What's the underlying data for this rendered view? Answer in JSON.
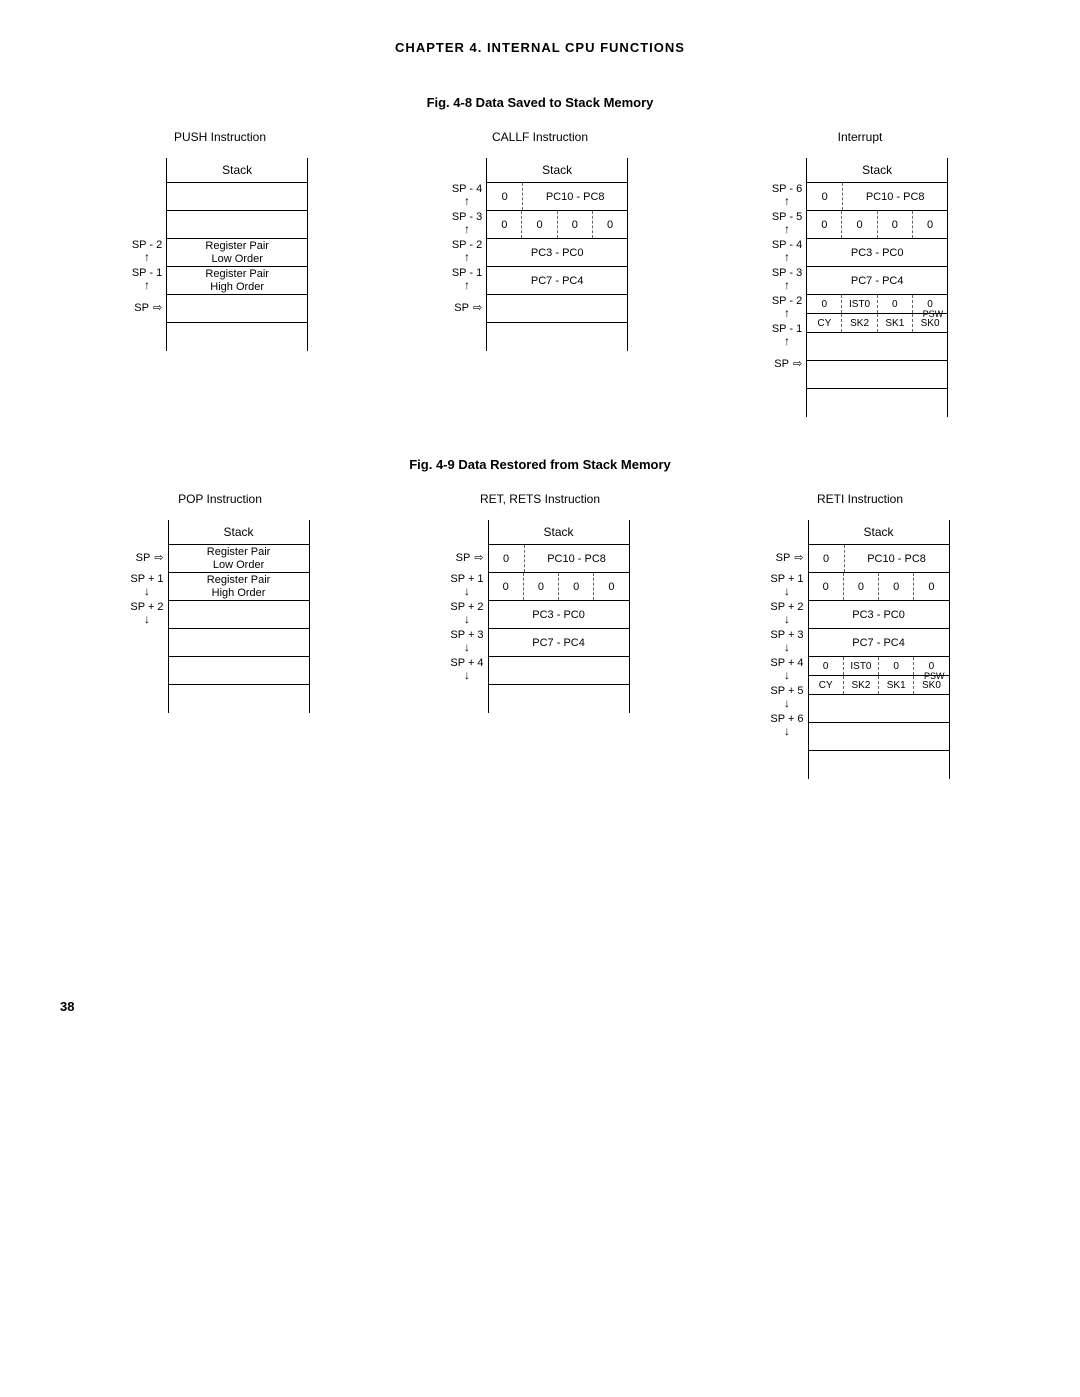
{
  "page_header": "CHAPTER  4.  INTERNAL  CPU  FUNCTIONS",
  "fig48_title": "Fig. 4-8 Data Saved to Stack Memory",
  "fig49_title": "Fig. 4-9 Data Restored from Stack Memory",
  "page_number": "38",
  "stack_label": "Stack",
  "push": {
    "title": "PUSH Instruction",
    "sp": [
      "",
      "",
      "SP - 2",
      "SP - 1",
      "SP",
      ""
    ],
    "cells": [
      {
        "type": "blank"
      },
      {
        "type": "blank"
      },
      {
        "type": "text2",
        "line1": "Register Pair",
        "line2": "Low Order"
      },
      {
        "type": "text2",
        "line1": "Register Pair",
        "line2": "High Order"
      },
      {
        "type": "blank"
      },
      {
        "type": "blank",
        "last": true
      }
    ]
  },
  "callf": {
    "title": "CALLF Instruction",
    "sp": [
      "SP - 4",
      "SP - 3",
      "SP - 2",
      "SP - 1",
      "SP",
      ""
    ],
    "cells": [
      {
        "type": "half",
        "left": "0",
        "right": "PC10 - PC8"
      },
      {
        "type": "nib",
        "v": [
          "0",
          "0",
          "0",
          "0"
        ]
      },
      {
        "type": "text",
        "text": "PC3 - PC0"
      },
      {
        "type": "text",
        "text": "PC7 - PC4"
      },
      {
        "type": "blank"
      },
      {
        "type": "blank",
        "last": true
      }
    ]
  },
  "interrupt": {
    "title": "Interrupt",
    "sp": [
      "SP - 6",
      "SP - 5",
      "SP - 4",
      "SP - 3",
      "SP - 2",
      "SP - 1",
      "SP",
      ""
    ],
    "cells": [
      {
        "type": "half",
        "left": "0",
        "right": "PC10 - PC8"
      },
      {
        "type": "nib",
        "v": [
          "0",
          "0",
          "0",
          "0"
        ]
      },
      {
        "type": "text",
        "text": "PC3 - PC0"
      },
      {
        "type": "text",
        "text": "PC7 - PC4"
      },
      {
        "type": "psw",
        "top": [
          "0",
          "IST0",
          "0",
          "0"
        ],
        "bot": [
          "CY",
          "SK2",
          "SK1",
          "SK0"
        ],
        "label": "PSW"
      },
      {
        "type": "blank"
      },
      {
        "type": "blank"
      },
      {
        "type": "blank",
        "last": true
      }
    ]
  },
  "pop": {
    "title": "POP Instruction",
    "sp": [
      "SP",
      "SP + 1",
      "SP + 2",
      "",
      "",
      ""
    ],
    "cells": [
      {
        "type": "text2",
        "line1": "Register Pair",
        "line2": "Low Order"
      },
      {
        "type": "text2",
        "line1": "Register Pair",
        "line2": "High Order"
      },
      {
        "type": "blank"
      },
      {
        "type": "blank"
      },
      {
        "type": "blank"
      },
      {
        "type": "blank",
        "last": true
      }
    ]
  },
  "ret": {
    "title": "RET, RETS Instruction",
    "sp": [
      "SP",
      "SP + 1",
      "SP + 2",
      "SP + 3",
      "SP + 4",
      ""
    ],
    "cells": [
      {
        "type": "half",
        "left": "0",
        "right": "PC10 - PC8"
      },
      {
        "type": "nib",
        "v": [
          "0",
          "0",
          "0",
          "0"
        ]
      },
      {
        "type": "text",
        "text": "PC3 - PC0"
      },
      {
        "type": "text",
        "text": "PC7 - PC4"
      },
      {
        "type": "blank"
      },
      {
        "type": "blank",
        "last": true
      }
    ]
  },
  "reti": {
    "title": "RETI Instruction",
    "sp": [
      "SP",
      "SP + 1",
      "SP + 2",
      "SP + 3",
      "SP + 4",
      "SP + 5",
      "SP + 6",
      ""
    ],
    "cells": [
      {
        "type": "half",
        "left": "0",
        "right": "PC10 - PC8"
      },
      {
        "type": "nib",
        "v": [
          "0",
          "0",
          "0",
          "0"
        ]
      },
      {
        "type": "text",
        "text": "PC3 - PC0"
      },
      {
        "type": "text",
        "text": "PC7 - PC4"
      },
      {
        "type": "psw",
        "top": [
          "0",
          "IST0",
          "0",
          "0"
        ],
        "bot": [
          "CY",
          "SK2",
          "SK1",
          "SK0"
        ],
        "label": "PSW"
      },
      {
        "type": "blank"
      },
      {
        "type": "blank"
      },
      {
        "type": "blank",
        "last": true
      }
    ]
  }
}
